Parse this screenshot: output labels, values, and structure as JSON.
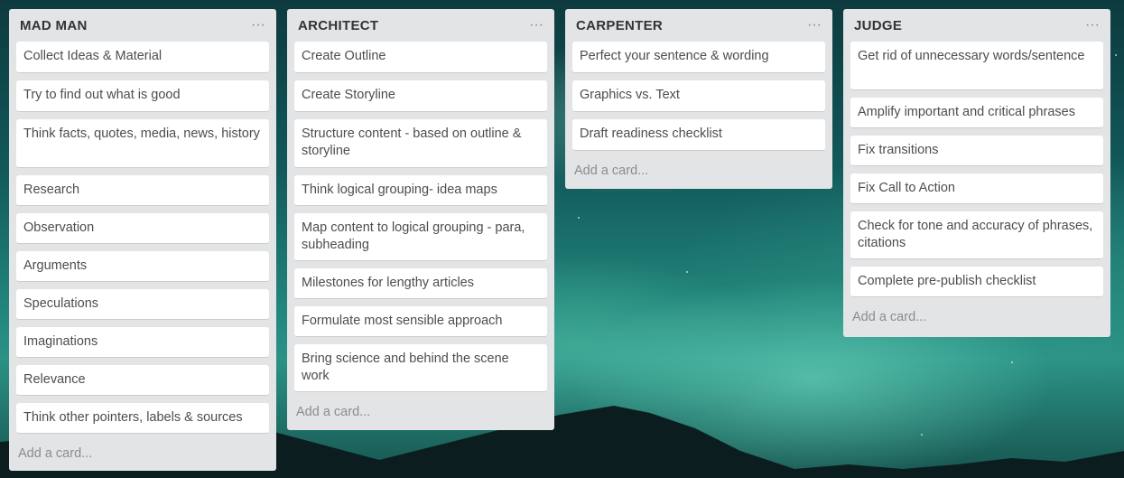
{
  "board": {
    "lists": [
      {
        "title": "MAD MAN",
        "menu_icon": "ellipsis-icon",
        "cards": [
          "Collect Ideas & Material",
          "Try to find out what is good",
          "Think facts, quotes, media, news, history",
          "Research",
          "Observation",
          "Arguments",
          "Speculations",
          "Imaginations",
          "Relevance",
          "Think other pointers, labels & sources"
        ],
        "add_card": "Add a card..."
      },
      {
        "title": "ARCHITECT",
        "menu_icon": "ellipsis-icon",
        "cards": [
          "Create Outline",
          "Create Storyline",
          "Structure content - based on outline & storyline",
          "Think logical grouping- idea maps",
          "Map content to logical grouping - para, subheading",
          "Milestones for lengthy articles",
          "Formulate most sensible approach",
          "Bring science and behind the scene work"
        ],
        "add_card": "Add a card..."
      },
      {
        "title": "CARPENTER",
        "menu_icon": "ellipsis-icon",
        "cards": [
          "Perfect your sentence & wording",
          "Graphics vs. Text",
          "Draft readiness checklist"
        ],
        "add_card": "Add a card..."
      },
      {
        "title": "JUDGE",
        "menu_icon": "ellipsis-icon",
        "cards": [
          "Get rid of unnecessary words/sentence",
          "Amplify important and critical phrases",
          "Fix transitions",
          "Fix Call to Action",
          "Check for tone and accuracy of phrases, citations",
          "Complete pre-publish checklist"
        ],
        "add_card": "Add a card..."
      }
    ]
  }
}
